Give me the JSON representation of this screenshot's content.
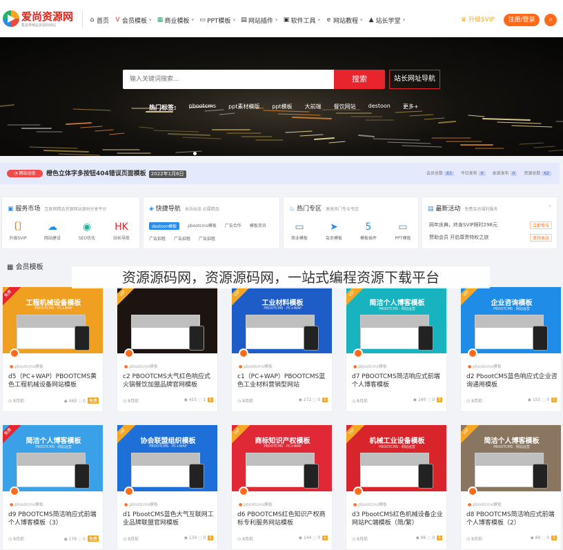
{
  "header": {
    "logo_title": "爱尚资源网",
    "logo_sub": "集各类精品资源的网站",
    "nav": [
      {
        "icon": "home-icon",
        "glyph": "⌂",
        "label": "首页",
        "color": "#333333"
      },
      {
        "icon": "vip-icon",
        "glyph": "V",
        "label": "会员模板",
        "color": "#e8242c"
      },
      {
        "icon": "grid-icon",
        "glyph": "▦",
        "label": "商业模板",
        "color": "#1fb36b"
      },
      {
        "icon": "monitor-icon",
        "glyph": "▭",
        "label": "PPT模板",
        "color": "#333333"
      },
      {
        "icon": "plugin-icon",
        "glyph": "▤",
        "label": "网站插件",
        "color": "#333333"
      },
      {
        "icon": "tool-icon",
        "glyph": "▣",
        "label": "软件工具",
        "color": "#333333"
      },
      {
        "icon": "e-icon",
        "glyph": "e",
        "label": "网站教程",
        "color": "#333333"
      },
      {
        "icon": "school-icon",
        "glyph": "▲",
        "label": "站长学堂",
        "color": "#333333"
      }
    ],
    "svip_label": "升级SVIP",
    "login_label": "注册/登录"
  },
  "hero": {
    "search_placeholder": "输入关键词搜索...",
    "search_button": "搜索",
    "nav_button": "站长网址导航",
    "hot_label": "热门标签:",
    "hot_tags": [
      "pbootcms",
      "ppt素材模版",
      "ppt模板",
      "大前端",
      "餐饮网站",
      "destoon",
      "更多+"
    ]
  },
  "notice": {
    "badge": "网站动态",
    "text": "橙色立体字多按钮404错误页面模板",
    "date": "2022年1月6日",
    "stats": [
      {
        "label": "会员总数",
        "value": "63"
      },
      {
        "label": "今日发布",
        "value": "0"
      },
      {
        "label": "本周发布",
        "value": "0"
      },
      {
        "label": "资源总数",
        "value": "62"
      }
    ]
  },
  "panels": {
    "service": {
      "title": "服务市场",
      "sub": "互联网精品资源网站源码分享平台",
      "items": [
        {
          "icon": "svip-icon",
          "glyph": "〔〕",
          "label": "升级SVIP",
          "color": "#ff6b1a"
        },
        {
          "icon": "cloud-icon",
          "glyph": "☁",
          "label": "网站建设",
          "color": "#2a8ee8"
        },
        {
          "icon": "seo-icon",
          "glyph": "◉",
          "label": "SEO优化",
          "color": "#1fb39a"
        },
        {
          "icon": "hk-icon",
          "glyph": "HK",
          "label": "站长导航",
          "color": "#e8242c"
        }
      ]
    },
    "quick": {
      "title": "快捷导航",
      "sub": "本站出品 必属精品",
      "tags": [
        "destoon模板",
        "pbootcms模板",
        "广告合作",
        "模板资讯",
        "广告招租",
        "广告招租",
        "广告招租"
      ]
    },
    "hot": {
      "title": "热门专区",
      "sub": "激发热门专业专区",
      "items": [
        {
          "icon": "laptop-icon",
          "glyph": "▭",
          "label": "商业模板",
          "color": "#2a8ee8"
        },
        {
          "icon": "send-icon",
          "glyph": "➤",
          "label": "会员模板",
          "color": "#2a8ee8"
        },
        {
          "icon": "html5-icon",
          "glyph": "5",
          "label": "模板插件",
          "color": "#2a8ee8"
        },
        {
          "icon": "monitor-icon",
          "glyph": "▭",
          "label": "PPT模板",
          "color": "#2a8ee8"
        }
      ]
    },
    "news": {
      "title": "最新活动",
      "sub": "免费会员福利服务",
      "rows": [
        {
          "text": "网年庆典，终身SVIP限时298元",
          "btn": "立即参与"
        },
        {
          "text": "赞助会员 开启尊贵特权之旅",
          "btn": "支持本站"
        }
      ]
    }
  },
  "section": {
    "title": "会员模板"
  },
  "overlay_text": "资源源码网，资源源码网，一站式编程资源下载平台",
  "cards": [
    {
      "ribbon": "免费",
      "ribbon_type": "free",
      "thumb_title": "工程机械设备模板",
      "thumb_sub": "PBOOTCMS · PC+WAP",
      "bg": "#f0a020",
      "category": "pbootcms模板",
      "title": "d5（PC+WAP）PBOOTCMS黄色工程机械设备网站模板",
      "date": "8月前",
      "views": "469",
      "comments": "0",
      "coin": "免费"
    },
    {
      "ribbon": "VIP",
      "ribbon_type": "vip",
      "thumb_title": "",
      "thumb_sub": "",
      "bg": "#1c1410",
      "category": "pbootcms模板",
      "title": "c2 PBOOTCMS大气红色响应式火锅餐饮加盟品牌官网模板",
      "date": "8月前",
      "views": "415",
      "comments": "1",
      "coin": "5"
    },
    {
      "ribbon": "VIP",
      "ribbon_type": "vip",
      "thumb_title": "工业材料模板",
      "thumb_sub": "PBOOTCMS · PC+WAP",
      "bg": "#1e5cc8",
      "category": "pbootcms模板",
      "title": "c1（PC+WAP）PBOOTCMS蓝色工业材料营销型网站",
      "date": "8月前",
      "views": "272",
      "comments": "0",
      "coin": "5"
    },
    {
      "ribbon": "VIP",
      "ribbon_type": "vip",
      "thumb_title": "简洁个人博客模板",
      "thumb_sub": "PBOOTCMS · 网站运营",
      "bg": "#17b3bf",
      "category": "pbootcms模板",
      "title": "d7 PBOOTCMS简洁响应式前端个人博客模板",
      "date": "8月前",
      "views": "160",
      "comments": "0",
      "coin": "5"
    },
    {
      "ribbon": "VIP",
      "ribbon_type": "vip",
      "thumb_title": "企业咨询模板",
      "thumb_sub": "PBOOTCMS · 网站运营",
      "bg": "#1f8de8",
      "category": "pbootcms模板",
      "title": "d2 PbootCMS蓝色响应式企业咨询通用模板",
      "date": "8月前",
      "views": "151",
      "comments": "0",
      "coin": "5"
    },
    {
      "ribbon": "免费",
      "ribbon_type": "free",
      "thumb_title": "简洁个人博客模板",
      "thumb_sub": "PBOOTCMS · 网站运营",
      "bg": "#3aa0e8",
      "category": "pbootcms模板",
      "title": "d9 PBOOTCMS简洁响应式前端个人博客模板（3）",
      "date": "8月前",
      "views": "179",
      "comments": "0",
      "coin": "免费"
    },
    {
      "ribbon": "VIP",
      "ribbon_type": "vip",
      "thumb_title": "协会联盟组织模板",
      "thumb_sub": "PBOOTCMS · PC+WAP",
      "bg": "#1e6fd8",
      "category": "pbootcms模板",
      "title": "d1 PbootCMS蓝色大气互联网工业品牌联盟官网模板",
      "date": "8月前",
      "views": "139",
      "comments": "0",
      "coin": "5"
    },
    {
      "ribbon": "VIP",
      "ribbon_type": "vip",
      "thumb_title": "商标知识产权模板",
      "thumb_sub": "PBOOTCMS · PC+WAP",
      "bg": "#e02836",
      "category": "pbootcms模板",
      "title": "d6 PBOOTCMS红色知识产权商标专利服务网站模板",
      "date": "8月前",
      "views": "144",
      "comments": "0",
      "coin": "5"
    },
    {
      "ribbon": "VIP",
      "ribbon_type": "vip",
      "thumb_title": "机械工业设备模板",
      "thumb_sub": "PBOOTCMS · 网站运营",
      "bg": "#d8252c",
      "category": "pbootcms模板",
      "title": "d3 PbootCMS红色机械设备企业网站PC端模板（简/繁）",
      "date": "8月前",
      "views": "96",
      "comments": "0",
      "coin": "5"
    },
    {
      "ribbon": "VIP",
      "ribbon_type": "vip",
      "thumb_title": "简洁个人博客模板",
      "thumb_sub": "PBOOTCMS · 网站运营",
      "bg": "#8a7660",
      "category": "pbootcms模板",
      "title": "d8 PBOOTCMS简洁响应式前端个人博客模板（2）",
      "date": "8月前",
      "views": "89",
      "comments": "0",
      "coin": "5"
    }
  ]
}
